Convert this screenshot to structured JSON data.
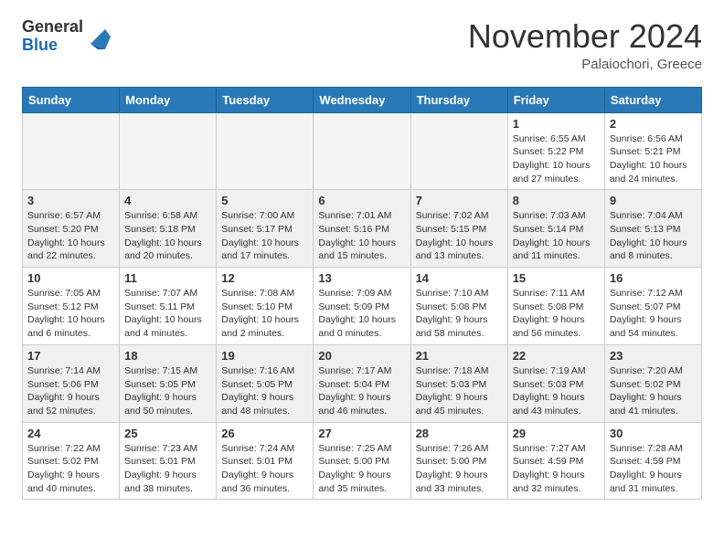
{
  "header": {
    "logo_general": "General",
    "logo_blue": "Blue",
    "month_title": "November 2024",
    "location": "Palaiochori, Greece"
  },
  "calendar": {
    "days_of_week": [
      "Sunday",
      "Monday",
      "Tuesday",
      "Wednesday",
      "Thursday",
      "Friday",
      "Saturday"
    ],
    "weeks": [
      {
        "days": [
          {
            "num": "",
            "info": ""
          },
          {
            "num": "",
            "info": ""
          },
          {
            "num": "",
            "info": ""
          },
          {
            "num": "",
            "info": ""
          },
          {
            "num": "",
            "info": ""
          },
          {
            "num": "1",
            "info": "Sunrise: 6:55 AM\nSunset: 5:22 PM\nDaylight: 10 hours\nand 27 minutes."
          },
          {
            "num": "2",
            "info": "Sunrise: 6:56 AM\nSunset: 5:21 PM\nDaylight: 10 hours\nand 24 minutes."
          }
        ]
      },
      {
        "days": [
          {
            "num": "3",
            "info": "Sunrise: 6:57 AM\nSunset: 5:20 PM\nDaylight: 10 hours\nand 22 minutes."
          },
          {
            "num": "4",
            "info": "Sunrise: 6:58 AM\nSunset: 5:18 PM\nDaylight: 10 hours\nand 20 minutes."
          },
          {
            "num": "5",
            "info": "Sunrise: 7:00 AM\nSunset: 5:17 PM\nDaylight: 10 hours\nand 17 minutes."
          },
          {
            "num": "6",
            "info": "Sunrise: 7:01 AM\nSunset: 5:16 PM\nDaylight: 10 hours\nand 15 minutes."
          },
          {
            "num": "7",
            "info": "Sunrise: 7:02 AM\nSunset: 5:15 PM\nDaylight: 10 hours\nand 13 minutes."
          },
          {
            "num": "8",
            "info": "Sunrise: 7:03 AM\nSunset: 5:14 PM\nDaylight: 10 hours\nand 11 minutes."
          },
          {
            "num": "9",
            "info": "Sunrise: 7:04 AM\nSunset: 5:13 PM\nDaylight: 10 hours\nand 8 minutes."
          }
        ]
      },
      {
        "days": [
          {
            "num": "10",
            "info": "Sunrise: 7:05 AM\nSunset: 5:12 PM\nDaylight: 10 hours\nand 6 minutes."
          },
          {
            "num": "11",
            "info": "Sunrise: 7:07 AM\nSunset: 5:11 PM\nDaylight: 10 hours\nand 4 minutes."
          },
          {
            "num": "12",
            "info": "Sunrise: 7:08 AM\nSunset: 5:10 PM\nDaylight: 10 hours\nand 2 minutes."
          },
          {
            "num": "13",
            "info": "Sunrise: 7:09 AM\nSunset: 5:09 PM\nDaylight: 10 hours\nand 0 minutes."
          },
          {
            "num": "14",
            "info": "Sunrise: 7:10 AM\nSunset: 5:08 PM\nDaylight: 9 hours\nand 58 minutes."
          },
          {
            "num": "15",
            "info": "Sunrise: 7:11 AM\nSunset: 5:08 PM\nDaylight: 9 hours\nand 56 minutes."
          },
          {
            "num": "16",
            "info": "Sunrise: 7:12 AM\nSunset: 5:07 PM\nDaylight: 9 hours\nand 54 minutes."
          }
        ]
      },
      {
        "days": [
          {
            "num": "17",
            "info": "Sunrise: 7:14 AM\nSunset: 5:06 PM\nDaylight: 9 hours\nand 52 minutes."
          },
          {
            "num": "18",
            "info": "Sunrise: 7:15 AM\nSunset: 5:05 PM\nDaylight: 9 hours\nand 50 minutes."
          },
          {
            "num": "19",
            "info": "Sunrise: 7:16 AM\nSunset: 5:05 PM\nDaylight: 9 hours\nand 48 minutes."
          },
          {
            "num": "20",
            "info": "Sunrise: 7:17 AM\nSunset: 5:04 PM\nDaylight: 9 hours\nand 46 minutes."
          },
          {
            "num": "21",
            "info": "Sunrise: 7:18 AM\nSunset: 5:03 PM\nDaylight: 9 hours\nand 45 minutes."
          },
          {
            "num": "22",
            "info": "Sunrise: 7:19 AM\nSunset: 5:03 PM\nDaylight: 9 hours\nand 43 minutes."
          },
          {
            "num": "23",
            "info": "Sunrise: 7:20 AM\nSunset: 5:02 PM\nDaylight: 9 hours\nand 41 minutes."
          }
        ]
      },
      {
        "days": [
          {
            "num": "24",
            "info": "Sunrise: 7:22 AM\nSunset: 5:02 PM\nDaylight: 9 hours\nand 40 minutes."
          },
          {
            "num": "25",
            "info": "Sunrise: 7:23 AM\nSunset: 5:01 PM\nDaylight: 9 hours\nand 38 minutes."
          },
          {
            "num": "26",
            "info": "Sunrise: 7:24 AM\nSunset: 5:01 PM\nDaylight: 9 hours\nand 36 minutes."
          },
          {
            "num": "27",
            "info": "Sunrise: 7:25 AM\nSunset: 5:00 PM\nDaylight: 9 hours\nand 35 minutes."
          },
          {
            "num": "28",
            "info": "Sunrise: 7:26 AM\nSunset: 5:00 PM\nDaylight: 9 hours\nand 33 minutes."
          },
          {
            "num": "29",
            "info": "Sunrise: 7:27 AM\nSunset: 4:59 PM\nDaylight: 9 hours\nand 32 minutes."
          },
          {
            "num": "30",
            "info": "Sunrise: 7:28 AM\nSunset: 4:59 PM\nDaylight: 9 hours\nand 31 minutes."
          }
        ]
      }
    ]
  }
}
